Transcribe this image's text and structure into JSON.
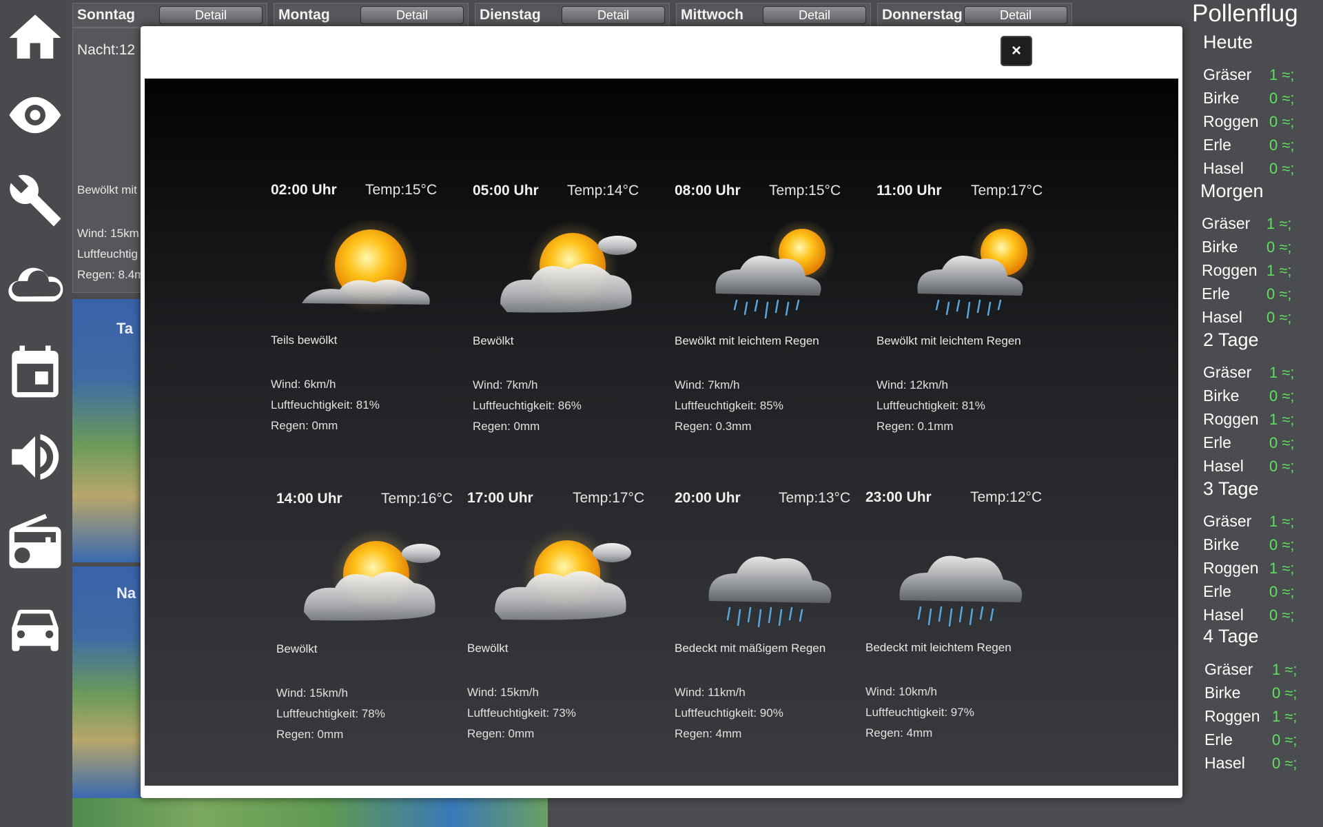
{
  "nav": {
    "items": [
      {
        "name": "home-icon"
      },
      {
        "name": "eye-icon"
      },
      {
        "name": "wrench-icon"
      },
      {
        "name": "cloud-icon"
      },
      {
        "name": "calendar-icon"
      },
      {
        "name": "speaker-icon"
      },
      {
        "name": "radio-icon"
      },
      {
        "name": "car-icon"
      }
    ]
  },
  "days": [
    {
      "name": "Sonntag",
      "detail": "Detail"
    },
    {
      "name": "Montag",
      "detail": "Detail"
    },
    {
      "name": "Dienstag",
      "detail": "Detail"
    },
    {
      "name": "Mittwoch",
      "detail": "Detail"
    },
    {
      "name": "Donnerstag",
      "detail": "Detail"
    }
  ],
  "sunday_panel": {
    "night": "Nacht:12",
    "desc": "Bewölkt mit",
    "wind": "Wind: 15km",
    "humidity": "Luftfeuchtig",
    "rain": "Regen: 8.4m"
  },
  "maps": {
    "top_label": "Ta",
    "bottom_label": "Na"
  },
  "pollen": {
    "title": "Pollenflug",
    "groups": [
      {
        "label": "Heute",
        "rows": [
          {
            "name": "Gräser",
            "value": "1 ≈;"
          },
          {
            "name": "Birke",
            "value": "0 ≈;"
          },
          {
            "name": "Roggen",
            "value": "0 ≈;"
          },
          {
            "name": "Erle",
            "value": "0 ≈;"
          },
          {
            "name": "Hasel",
            "value": "0 ≈;"
          }
        ]
      },
      {
        "label": "Morgen",
        "rows": [
          {
            "name": "Gräser",
            "value": "1 ≈;"
          },
          {
            "name": "Birke",
            "value": "0 ≈;"
          },
          {
            "name": "Roggen",
            "value": "1 ≈;"
          },
          {
            "name": "Erle",
            "value": "0 ≈;"
          },
          {
            "name": "Hasel",
            "value": "0 ≈;"
          }
        ]
      },
      {
        "label": "2 Tage",
        "rows": [
          {
            "name": "Gräser",
            "value": "1 ≈;"
          },
          {
            "name": "Birke",
            "value": "0 ≈;"
          },
          {
            "name": "Roggen",
            "value": "1 ≈;"
          },
          {
            "name": "Erle",
            "value": "0 ≈;"
          },
          {
            "name": "Hasel",
            "value": "0 ≈;"
          }
        ]
      },
      {
        "label": "3 Tage",
        "rows": [
          {
            "name": "Gräser",
            "value": "1 ≈;"
          },
          {
            "name": "Birke",
            "value": "0 ≈;"
          },
          {
            "name": "Roggen",
            "value": "1 ≈;"
          },
          {
            "name": "Erle",
            "value": "0 ≈;"
          },
          {
            "name": "Hasel",
            "value": "0 ≈;"
          }
        ]
      },
      {
        "label": "4 Tage",
        "rows": [
          {
            "name": "Gräser",
            "value": "1 ≈;"
          },
          {
            "name": "Birke",
            "value": "0 ≈;"
          },
          {
            "name": "Roggen",
            "value": "1 ≈;"
          },
          {
            "name": "Erle",
            "value": "0 ≈;"
          },
          {
            "name": "Hasel",
            "value": "0 ≈;"
          }
        ]
      }
    ]
  },
  "modal": {
    "close_label": "×",
    "slots": [
      {
        "time": "02:00 Uhr",
        "temp": "Temp:15°C",
        "icon": "sun-cloud-icon",
        "desc": "Teils bewölkt",
        "wind": "Wind: 6km/h",
        "humidity": "Luftfeuchtigkeit: 81%",
        "rain": "Regen: 0mm"
      },
      {
        "time": "05:00 Uhr",
        "temp": "Temp:14°C",
        "icon": "cloudy-sun-icon",
        "desc": "Bewölkt",
        "wind": "Wind: 7km/h",
        "humidity": "Luftfeuchtigkeit: 86%",
        "rain": "Regen: 0mm"
      },
      {
        "time": "08:00 Uhr",
        "temp": "Temp:15°C",
        "icon": "sun-rain-cloud-icon",
        "desc": "Bewölkt mit leichtem Regen",
        "wind": "Wind: 7km/h",
        "humidity": "Luftfeuchtigkeit: 85%",
        "rain": "Regen: 0.3mm"
      },
      {
        "time": "11:00 Uhr",
        "temp": "Temp:17°C",
        "icon": "sun-rain-cloud-icon",
        "desc": "Bewölkt mit leichtem Regen",
        "wind": "Wind: 12km/h",
        "humidity": "Luftfeuchtigkeit: 81%",
        "rain": "Regen: 0.1mm"
      },
      {
        "time": "14:00 Uhr",
        "temp": "Temp:16°C",
        "icon": "cloudy-sun-icon",
        "desc": "Bewölkt",
        "wind": "Wind: 15km/h",
        "humidity": "Luftfeuchtigkeit: 78%",
        "rain": "Regen: 0mm"
      },
      {
        "time": "17:00 Uhr",
        "temp": "Temp:17°C",
        "icon": "cloudy-sun-icon",
        "desc": "Bewölkt",
        "wind": "Wind: 15km/h",
        "humidity": "Luftfeuchtigkeit: 73%",
        "rain": "Regen: 0mm"
      },
      {
        "time": "20:00 Uhr",
        "temp": "Temp:13°C",
        "icon": "rain-cloud-icon",
        "desc": "Bedeckt mit mäßigem Regen",
        "wind": "Wind: 11km/h",
        "humidity": "Luftfeuchtigkeit: 90%",
        "rain": "Regen: 4mm"
      },
      {
        "time": "23:00 Uhr",
        "temp": "Temp:12°C",
        "icon": "rain-cloud-icon",
        "desc": "Bedeckt mit leichtem Regen",
        "wind": "Wind: 10km/h",
        "humidity": "Luftfeuchtigkeit: 97%",
        "rain": "Regen: 4mm"
      }
    ]
  }
}
